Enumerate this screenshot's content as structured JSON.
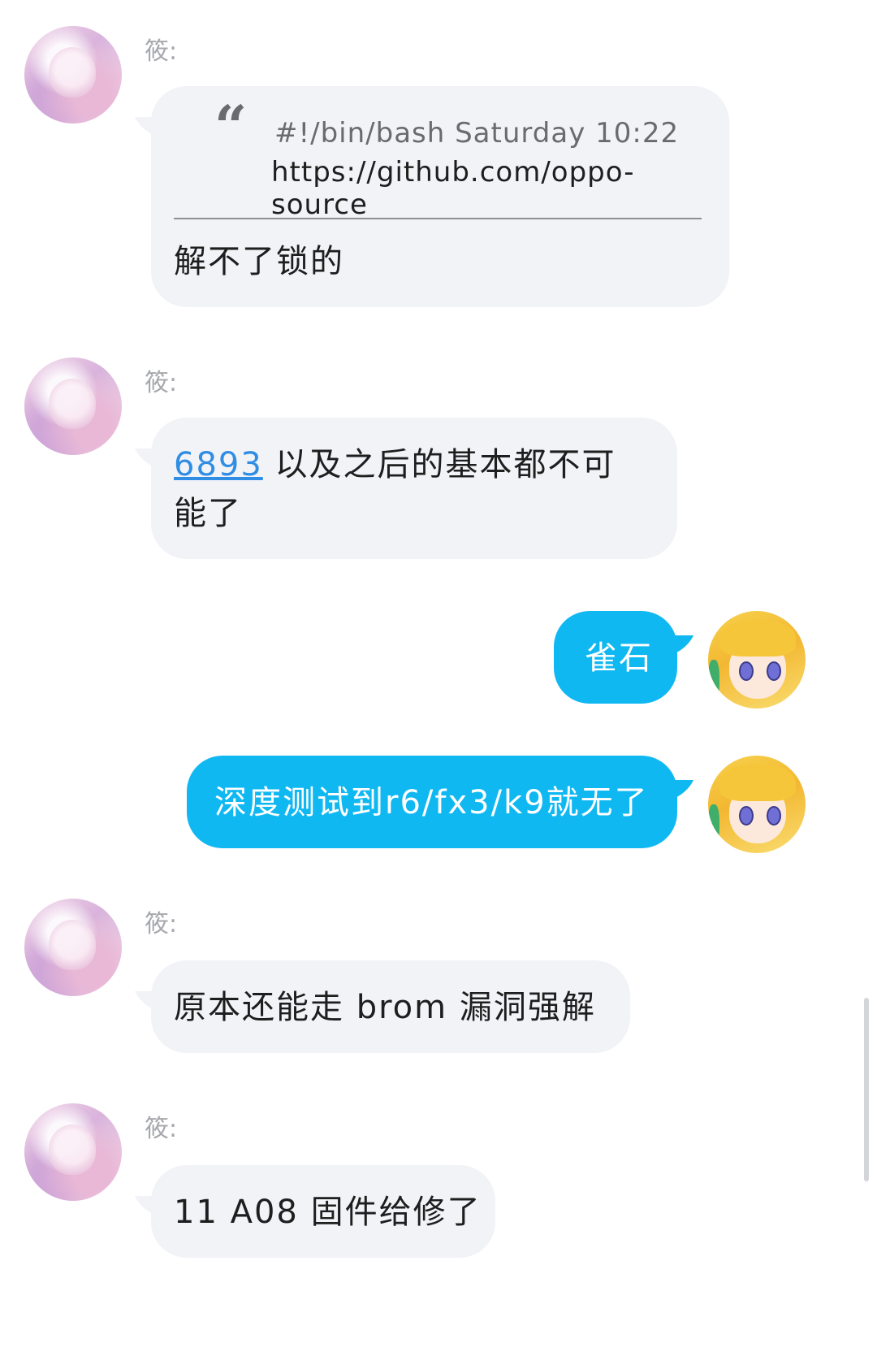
{
  "messages": [
    {
      "sender": "筱:",
      "quote": {
        "mark": "“",
        "meta": "#!/bin/bash Saturday 10:22",
        "body": "https://github.com/oppo-source"
      },
      "text": "解不了锁的"
    },
    {
      "sender": "筱:",
      "link_text": "6893",
      "text_line1": " 以及之后的基本都不可",
      "text_line2": "能了"
    },
    {
      "text": "雀石"
    },
    {
      "text": "深度测试到r6/fx3/k9就无了"
    },
    {
      "sender": "筱:",
      "text": "原本还能走 brom 漏洞强解"
    },
    {
      "sender": "筱:",
      "text": "11 A08 固件给修了"
    }
  ],
  "colors": {
    "incoming_bubble": "#f2f3f7",
    "outgoing_bubble": "#10b8f2",
    "link": "#2f8de4",
    "sender_name": "#a6a8ad"
  },
  "icons": {
    "peer_avatar": "anime-girl-pink-avatar",
    "self_avatar": "anime-girl-blonde-avatar"
  }
}
